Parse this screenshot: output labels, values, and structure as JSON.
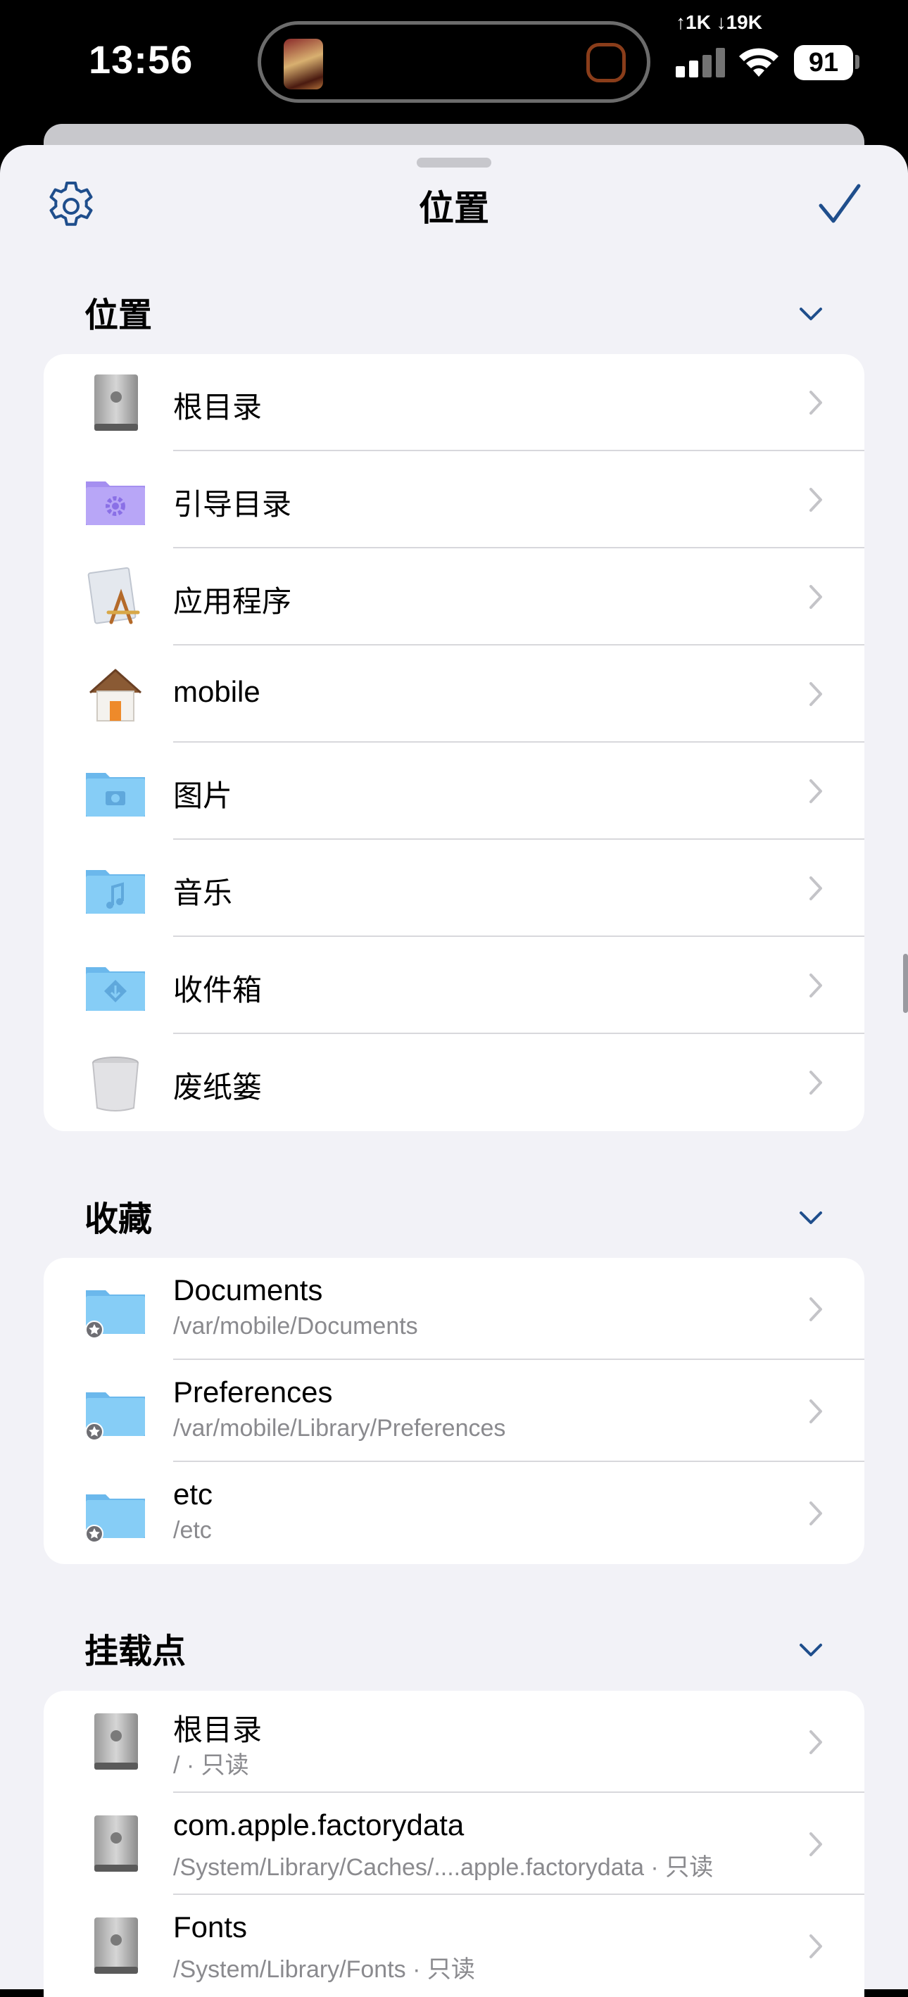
{
  "status_bar": {
    "time": "13:56",
    "network_speed": "↑1K ↓19K",
    "battery": "91"
  },
  "sheet": {
    "title": "位置",
    "settings_icon": "gear-icon",
    "done_icon": "checkmark-icon"
  },
  "sections": {
    "locations": {
      "title": "位置",
      "items": [
        {
          "label": "根目录",
          "icon": "drive-icon"
        },
        {
          "label": "引导目录",
          "icon": "purple-gear-folder-icon"
        },
        {
          "label": "应用程序",
          "icon": "applications-icon"
        },
        {
          "label": "mobile",
          "icon": "home-icon"
        },
        {
          "label": "图片",
          "icon": "pictures-folder-icon"
        },
        {
          "label": "音乐",
          "icon": "music-folder-icon"
        },
        {
          "label": "收件箱",
          "icon": "inbox-folder-icon"
        },
        {
          "label": "废纸篓",
          "icon": "trash-icon"
        }
      ]
    },
    "favorites": {
      "title": "收藏",
      "items": [
        {
          "label": "Documents",
          "path": "/var/mobile/Documents",
          "icon": "favorite-folder-icon"
        },
        {
          "label": "Preferences",
          "path": "/var/mobile/Library/Preferences",
          "icon": "favorite-folder-icon"
        },
        {
          "label": "etc",
          "path": "/etc",
          "icon": "favorite-folder-icon"
        }
      ]
    },
    "mounts": {
      "title": "挂载点",
      "items": [
        {
          "label": "根目录",
          "path": "/ · 只读",
          "icon": "drive-icon"
        },
        {
          "label": "com.apple.factorydata",
          "path": "/System/Library/Caches/....apple.factorydata · 只读",
          "icon": "drive-icon"
        },
        {
          "label": "Fonts",
          "path": "/System/Library/Fonts · 只读",
          "icon": "drive-icon"
        }
      ]
    }
  },
  "colors": {
    "accent": "#1f4e8c",
    "background": "#f2f2f7",
    "folder_blue": "#7cc4f2",
    "secondary_text": "#8a8a8e"
  }
}
